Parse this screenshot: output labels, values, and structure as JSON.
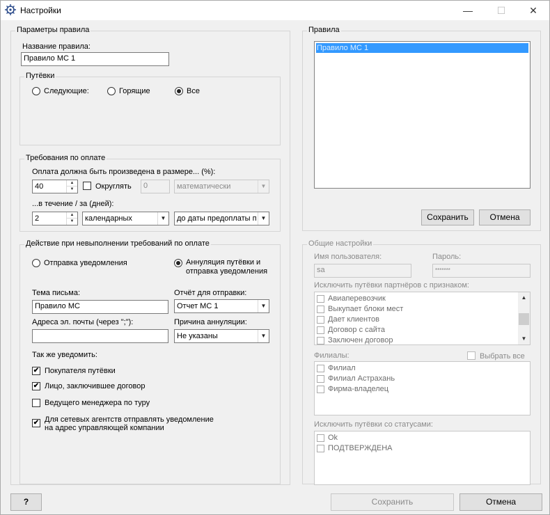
{
  "window": {
    "title": "Настройки",
    "minimize": "—",
    "maximize": "☐",
    "close": "✕"
  },
  "rule_params": {
    "legend": "Параметры правила",
    "name_label": "Название правила:",
    "name_value": "Правило МС 1",
    "tours": {
      "legend": "Путёвки",
      "options": [
        "Следующие:",
        "Горящие",
        "Все"
      ],
      "selected": "Все"
    }
  },
  "payment_req": {
    "legend": "Требования по оплате",
    "amount_label": "Оплата должна быть произведена в размере... (%):",
    "amount_value": "40",
    "round_label": "Округлять",
    "round_checked": false,
    "round_value": "0",
    "round_mode": "математически",
    "term_label": "...в течение / за (дней):",
    "days_value": "2",
    "days_type": "календарных",
    "from_date": "до даты предоплаты по"
  },
  "action": {
    "legend": "Действие при невыполнении требований по оплате",
    "option1": "Отправка уведомления",
    "option2_line1": "Аннуляция путёвки и",
    "option2_line2": "отправка уведомления",
    "selected": "option2",
    "subject_label": "Тема письма:",
    "subject_value": "Правило МС",
    "report_label": "Отчёт для отправки:",
    "report_value": "Отчет МС 1",
    "emails_label": "Адреса эл. почты (через \";\"):",
    "emails_value": "",
    "cancel_reason_label": "Причина аннуляции:",
    "cancel_reason_value": "Не указаны",
    "also_notify_label": "Так же уведомить:",
    "notify": [
      {
        "label": "Покупателя путёвки",
        "checked": true
      },
      {
        "label": "Лицо, заключившее договор",
        "checked": true
      },
      {
        "label": "Ведущего менеджера по туру",
        "checked": false
      }
    ],
    "network_line1": "Для сетевых агентств отправлять уведомление",
    "network_line2": "на адрес управляющей компании",
    "network_checked": true
  },
  "rules": {
    "legend": "Правила",
    "items": [
      "Правило МС 1"
    ],
    "save": "Сохранить",
    "cancel": "Отмена"
  },
  "general": {
    "legend": "Общие настройки",
    "user_label": "Имя пользователя:",
    "user_value": "sa",
    "password_label": "Пароль:",
    "password_value": "*******",
    "exclude_partners_label": "Исключить путёвки партнёров с признаком:",
    "partner_flags": [
      "Авиаперевозчик",
      "Выкупает блоки мест",
      "Дает клиентов",
      "Договор с сайта",
      "Заключен договор"
    ],
    "branches_label": "Филиалы:",
    "select_all": "Выбрать все",
    "branches": [
      "Филиал",
      "Филиал Астрахань",
      "Фирма-владелец"
    ],
    "exclude_statuses_label": "Исключить путёвки со статусами:",
    "statuses": [
      "Ok",
      "ПОДТВЕРЖДЕНА"
    ]
  },
  "footer": {
    "help": "?",
    "save": "Сохранить",
    "cancel": "Отмена"
  },
  "colors": {
    "selection": "#3399ff",
    "background": "#f0f0f0"
  }
}
